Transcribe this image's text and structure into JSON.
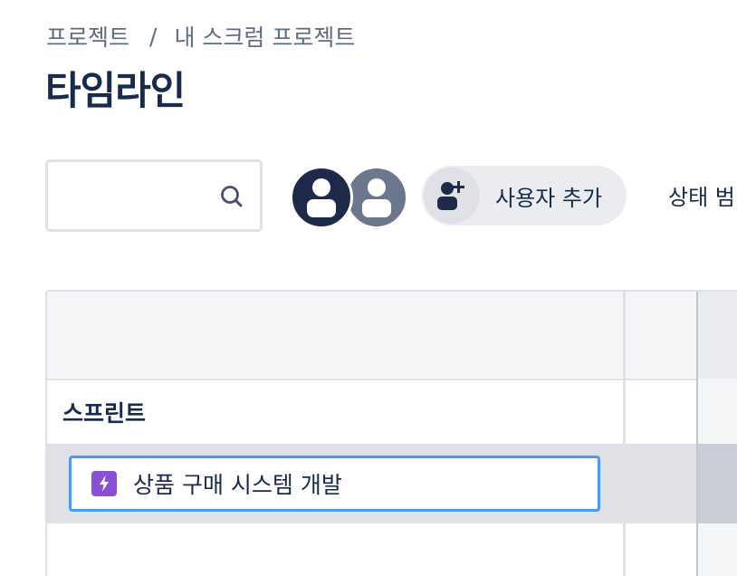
{
  "breadcrumb": {
    "items": [
      "프로젝트",
      "내 스크럼 프로젝트"
    ],
    "separator": "/"
  },
  "page": {
    "title": "타임라인"
  },
  "search": {
    "placeholder": "",
    "value": ""
  },
  "avatars": [
    {
      "name": "avatar-user-1",
      "color": "#1e2a4a"
    },
    {
      "name": "avatar-user-2",
      "color": "#6b778c"
    }
  ],
  "toolbar": {
    "add_user_label": "사용자 추가",
    "status_filter_label": "상태 범"
  },
  "timeline": {
    "sprint_label": "스프린트",
    "epics": [
      {
        "title": "상품 구매 시스템 개발",
        "icon": "lightning-icon",
        "color": "#8a4fd7"
      }
    ]
  },
  "colors": {
    "accent": "#4c9aff",
    "text": "#172b4d",
    "muted": "#5e6c84",
    "epic": "#8a4fd7"
  }
}
